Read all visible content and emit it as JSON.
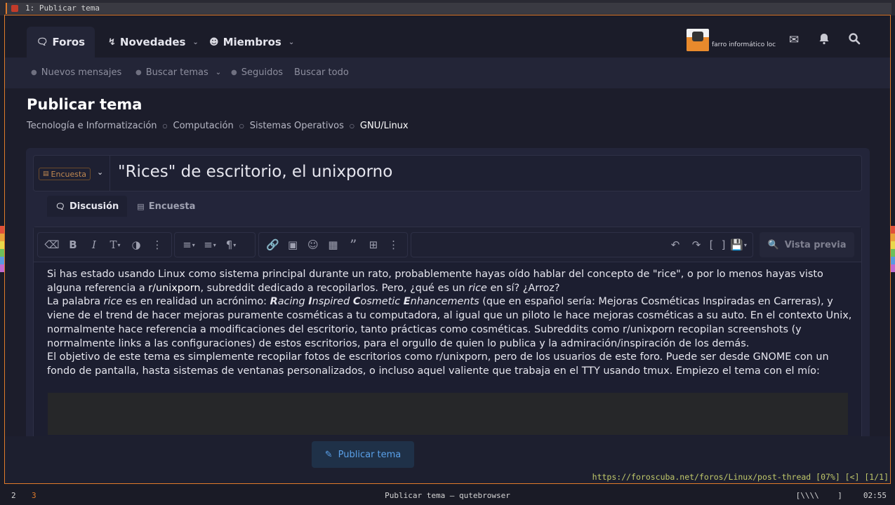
{
  "browser": {
    "tab_title": "1: Publicar tema",
    "url_status": "https://foroscuba.net/foros/Linux/post-thread [07%] [<] [1/1]"
  },
  "header": {
    "nav": [
      {
        "label": "Foros",
        "icon": "forum-icon"
      },
      {
        "label": "Novedades",
        "icon": "bolt-icon"
      },
      {
        "label": "Miembros",
        "icon": "users-icon"
      }
    ],
    "username": "farro informático loc"
  },
  "subnav": {
    "items": [
      "Nuevos mensajes",
      "Buscar temas",
      "Seguidos",
      "Buscar todo"
    ]
  },
  "page": {
    "title": "Publicar tema",
    "breadcrumbs": [
      "Tecnología e Informatización",
      "Computación",
      "Sistemas Operativos",
      "GNU/Linux"
    ]
  },
  "form": {
    "prefix_label": "Encuesta",
    "thread_title": "\"Rices\" de escritorio, el unixporno",
    "tabs": [
      "Discusión",
      "Encuesta"
    ],
    "preview_label": "Vista previa",
    "submit_label": "Publicar tema"
  },
  "body": {
    "p1a": "Si has estado usando Linux como sistema principal durante un rato, probablemente hayas oído hablar del concepto de \"rice\", o por lo menos hayas visto alguna referencia a ",
    "p1_link": "r/unixporn",
    "p1b": ", subreddit dedicado a recopilarlos. Pero, ¿qué es un ",
    "p1_em": "rice",
    "p1c": " en sí? ¿Arroz?",
    "p2a": "La palabra ",
    "p2_em": "rice",
    "p2b": " es en realidad un acrónimo: ",
    "acr_r": "R",
    "acr_r_rest": "acing ",
    "acr_i": "I",
    "acr_i_rest": "nspired ",
    "acr_c": "C",
    "acr_c_rest": "osmetic ",
    "acr_e": "E",
    "acr_e_rest": "nhancements",
    "p2c": " (que en español sería: Mejoras Cosméticas Inspiradas en Carreras), y viene de el trend de hacer mejoras puramente cosméticas a tu computadora, al igual que un piloto le hace mejoras cosméticas a su auto. En el contexto Unix, normalmente hace referencia a modificaciones del escritorio, tanto prácticas como cosméticas. Subreddits como r/unixporn recopilan screenshots (y normalmente links a las configuraciones) de estos escritorios, para el orgullo de quien lo publica y la admiración/inspiración de los demás.",
    "p3": "El objetivo de este tema es simplemente recopilar fotos de escritorios como r/unixporn, pero de los usuarios de este foro. Puede ser desde GNOME con un fondo de pantalla, hasta sistemas de ventanas personalizados, o incluso aquel valiente que trabaja en el TTY usando tmux. Empiezo el tema con el mío:"
  },
  "bar": {
    "ws1": "2",
    "ws2": "3",
    "window_title": "Publicar tema — qutebrowser",
    "indicator": "[\\\\\\\\    ]",
    "clock": "02:55"
  },
  "colors": {
    "accent": "#e07b2a",
    "link": "#5aa0e8",
    "bg": "#1c1d2b"
  }
}
